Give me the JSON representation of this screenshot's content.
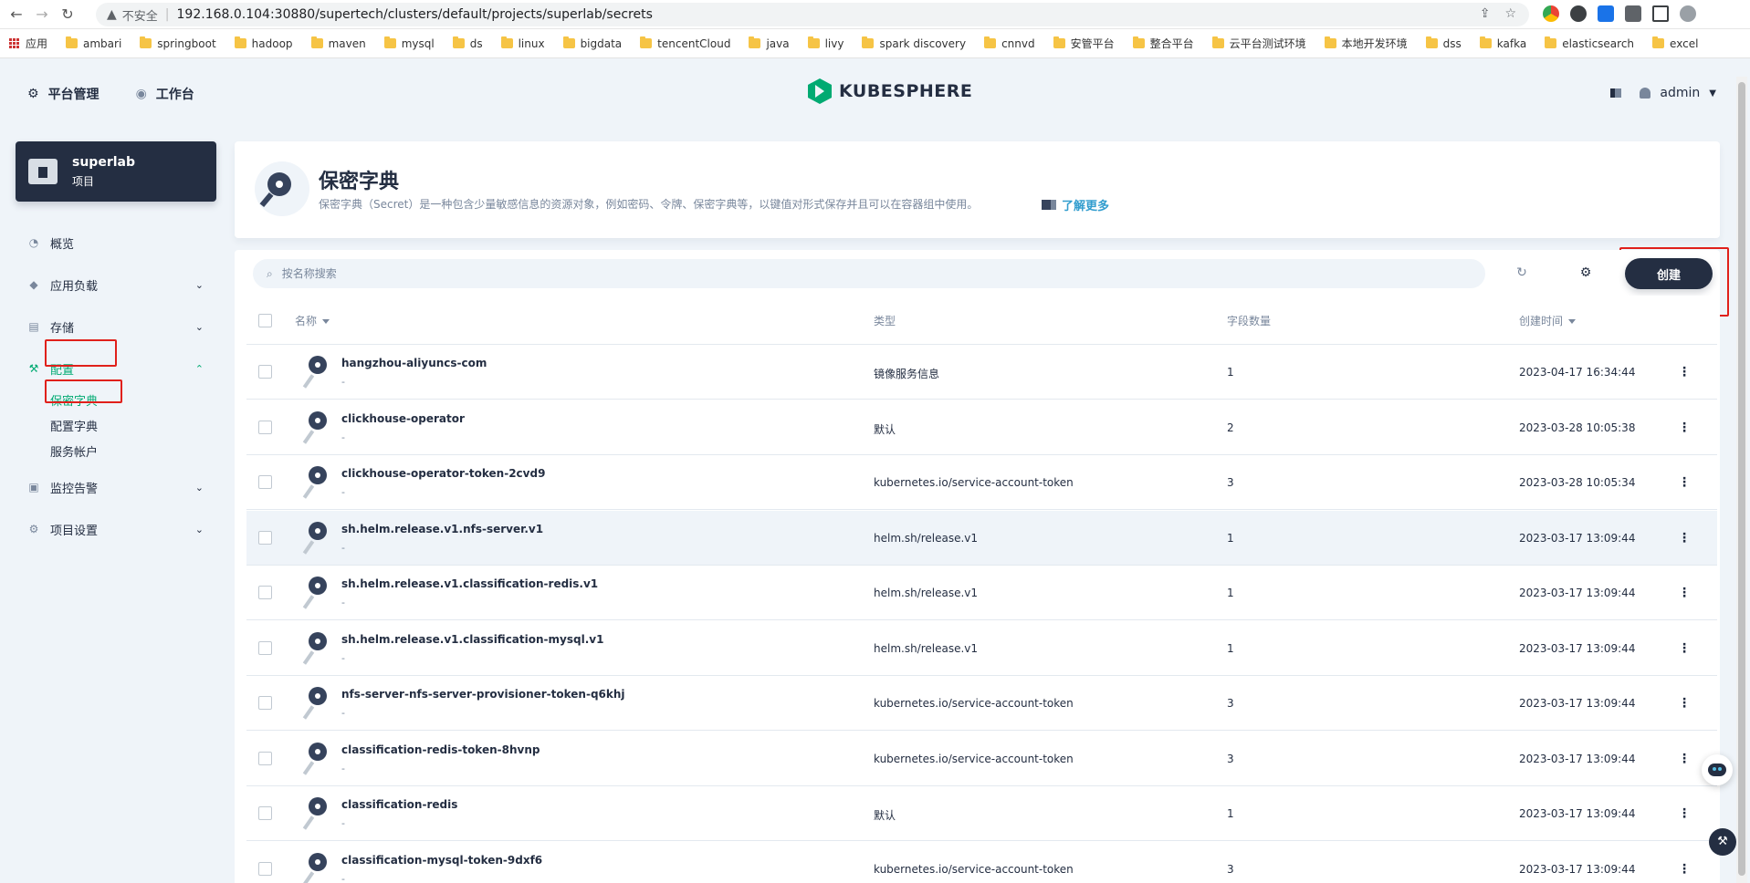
{
  "browser": {
    "insecure_label": "不安全",
    "url": "192.168.0.104:30880/supertech/clusters/default/projects/superlab/secrets",
    "bookmarks": [
      "应用",
      "ambari",
      "springboot",
      "hadoop",
      "maven",
      "mysql",
      "ds",
      "linux",
      "bigdata",
      "tencentCloud",
      "java",
      "livy",
      "spark discovery",
      "cnnvd",
      "安管平台",
      "整合平台",
      "云平台测试环境",
      "本地开发环境",
      "dss",
      "kafka",
      "elasticsearch",
      "excel"
    ]
  },
  "header": {
    "platform_label": "平台管理",
    "workbench_label": "工作台",
    "logo_text": "KUBESPHERE",
    "user": "admin"
  },
  "sidebar": {
    "project_name": "superlab",
    "project_type": "项目",
    "items": [
      {
        "label": "概览",
        "icon": "dashboard-icon"
      },
      {
        "label": "应用负载",
        "icon": "layers-icon"
      },
      {
        "label": "存储",
        "icon": "database-icon"
      },
      {
        "label": "配置",
        "icon": "hammer-icon"
      },
      {
        "label": "监控告警",
        "icon": "monitor-icon"
      },
      {
        "label": "项目设置",
        "icon": "gear-icon"
      }
    ],
    "config_children": [
      "保密字典",
      "配置字典",
      "服务帐户"
    ]
  },
  "banner": {
    "title": "保密字典",
    "description": "保密字典（Secret）是一种包含少量敏感信息的资源对象，例如密码、令牌、保密字典等，以键值对形式保存并且可以在容器组中使用。",
    "learn_more": "了解更多"
  },
  "toolbar": {
    "search_placeholder": "按名称搜索",
    "create_label": "创建"
  },
  "table": {
    "headers": {
      "name": "名称",
      "type": "类型",
      "fields": "字段数量",
      "created": "创建时间"
    },
    "rows": [
      {
        "name": "hangzhou-aliyuncs-com",
        "desc": "-",
        "type": "镜像服务信息",
        "fields": "1",
        "created": "2023-04-17 16:34:44"
      },
      {
        "name": "clickhouse-operator",
        "desc": "-",
        "type": "默认",
        "fields": "2",
        "created": "2023-03-28 10:05:38"
      },
      {
        "name": "clickhouse-operator-token-2cvd9",
        "desc": "-",
        "type": "kubernetes.io/service-account-token",
        "fields": "3",
        "created": "2023-03-28 10:05:34"
      },
      {
        "name": "sh.helm.release.v1.nfs-server.v1",
        "desc": "-",
        "type": "helm.sh/release.v1",
        "fields": "1",
        "created": "2023-03-17 13:09:44"
      },
      {
        "name": "sh.helm.release.v1.classification-redis.v1",
        "desc": "-",
        "type": "helm.sh/release.v1",
        "fields": "1",
        "created": "2023-03-17 13:09:44"
      },
      {
        "name": "sh.helm.release.v1.classification-mysql.v1",
        "desc": "-",
        "type": "helm.sh/release.v1",
        "fields": "1",
        "created": "2023-03-17 13:09:44"
      },
      {
        "name": "nfs-server-nfs-server-provisioner-token-q6khj",
        "desc": "-",
        "type": "kubernetes.io/service-account-token",
        "fields": "3",
        "created": "2023-03-17 13:09:44"
      },
      {
        "name": "classification-redis-token-8hvnp",
        "desc": "-",
        "type": "kubernetes.io/service-account-token",
        "fields": "3",
        "created": "2023-03-17 13:09:44"
      },
      {
        "name": "classification-redis",
        "desc": "-",
        "type": "默认",
        "fields": "1",
        "created": "2023-03-17 13:09:44"
      },
      {
        "name": "classification-mysql-token-9dxf6",
        "desc": "-",
        "type": "kubernetes.io/service-account-token",
        "fields": "3",
        "created": "2023-03-17 13:09:44"
      }
    ]
  },
  "colors": {
    "accent": "#00aa72",
    "dark": "#242e42",
    "annotation": "#e0201b"
  }
}
